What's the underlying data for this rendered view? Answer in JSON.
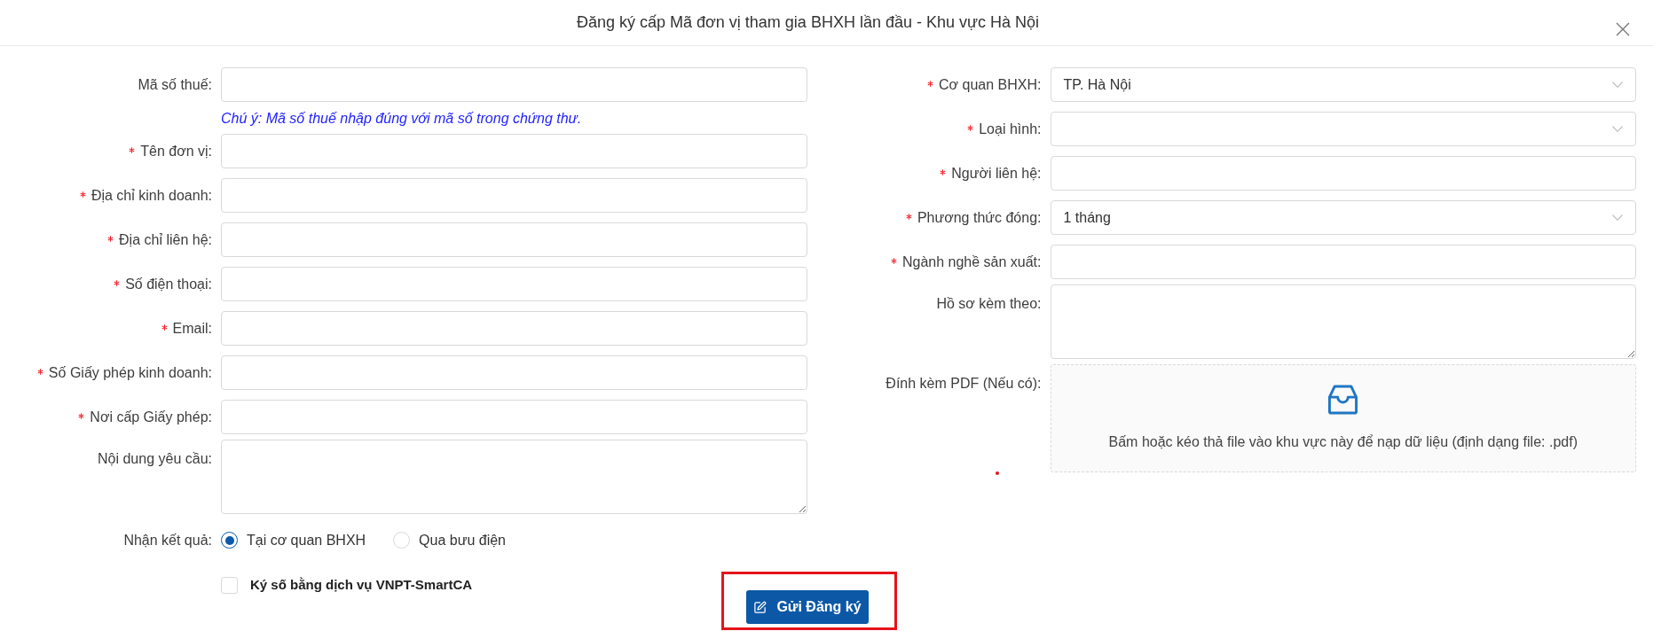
{
  "dialog": {
    "title": "Đăng ký cấp Mã đơn vị tham gia BHXH lần đầu - Khu vực Hà Nội"
  },
  "left_fields": [
    {
      "kind": "input",
      "label": "Mã số thuế:",
      "required": false,
      "note": "Chú ý: Mã số thuế nhập đúng với mã số trong chứng thư."
    },
    {
      "kind": "input",
      "label": "Tên đơn vị:",
      "required": true
    },
    {
      "kind": "input",
      "label": "Địa chỉ kinh doanh:",
      "required": true
    },
    {
      "kind": "input",
      "label": "Địa chỉ liên hệ:",
      "required": true
    },
    {
      "kind": "input",
      "label": "Số điện thoại:",
      "required": true
    },
    {
      "kind": "input",
      "label": "Email:",
      "required": true
    },
    {
      "kind": "input",
      "label": "Số Giấy phép kinh doanh:",
      "required": true
    },
    {
      "kind": "input",
      "label": "Nơi cấp Giấy phép:",
      "required": true
    },
    {
      "kind": "textarea",
      "label": "Nội dung yêu cầu:",
      "required": false
    }
  ],
  "result_delivery": {
    "label": "Nhận kết quả:",
    "options": [
      {
        "label": "Tại cơ quan BHXH",
        "selected": true
      },
      {
        "label": "Qua bưu điện",
        "selected": false
      }
    ]
  },
  "right_fields": [
    {
      "kind": "select",
      "label": "Cơ quan BHXH:",
      "required": true,
      "value": "TP. Hà Nội"
    },
    {
      "kind": "select",
      "label": "Loại hình:",
      "required": true
    },
    {
      "kind": "input",
      "label": "Người liên hệ:",
      "required": true
    },
    {
      "kind": "select",
      "label": "Phương thức đóng:",
      "required": true,
      "value": "1 tháng"
    },
    {
      "kind": "input",
      "label": "Ngành nghề sản xuất:",
      "required": true
    },
    {
      "kind": "textarea",
      "label": "Hồ sơ kèm theo:",
      "required": false
    },
    {
      "kind": "dropzone",
      "label": "Đính kèm PDF (Nếu có):",
      "required": false,
      "hint": "Bấm hoặc kéo thả file vào khu vực này để nạp dữ liệu (định dạng file: .pdf)"
    }
  ],
  "digital_signature": {
    "label": "Ký số bằng dịch vụ VNPT-SmartCA",
    "checked": false
  },
  "submit_button": {
    "label": "Gửi Đăng ký",
    "highlighted": true
  }
}
